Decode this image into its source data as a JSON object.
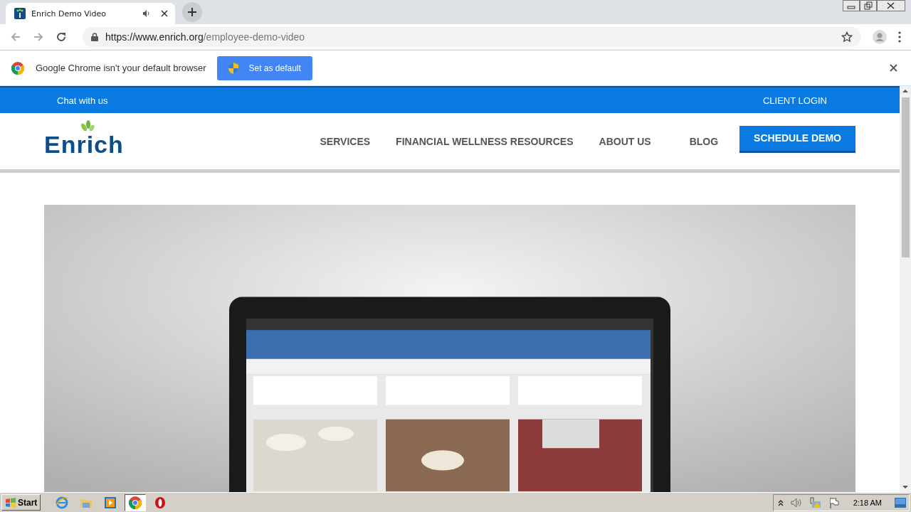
{
  "tabs": [
    {
      "title": "Enrich Demo Video",
      "selected": true,
      "audio": true
    }
  ],
  "address": {
    "host": "https://www.enrich.org",
    "path": "/employee-demo-video"
  },
  "infobar": {
    "message": "Google Chrome isn't your default browser",
    "button": "Set as default"
  },
  "site": {
    "topbar": {
      "chat": "Chat with us",
      "login": "CLIENT LOGIN"
    },
    "logo": "Enrich",
    "nav": [
      "SERVICES",
      "FINANCIAL WELLNESS RESOURCES",
      "ABOUT US",
      "BLOG"
    ],
    "cta": "SCHEDULE DEMO",
    "video": {
      "kind": "picture"
    }
  },
  "taskbar": {
    "start": "Start",
    "apps": [
      {
        "kind": "ie",
        "selected": false
      },
      {
        "kind": "folder",
        "selected": false
      },
      {
        "kind": "media",
        "selected": false
      },
      {
        "kind": "chrome",
        "selected": true
      },
      {
        "kind": "opera",
        "selected": false
      }
    ],
    "clock": "2:18 AM"
  }
}
